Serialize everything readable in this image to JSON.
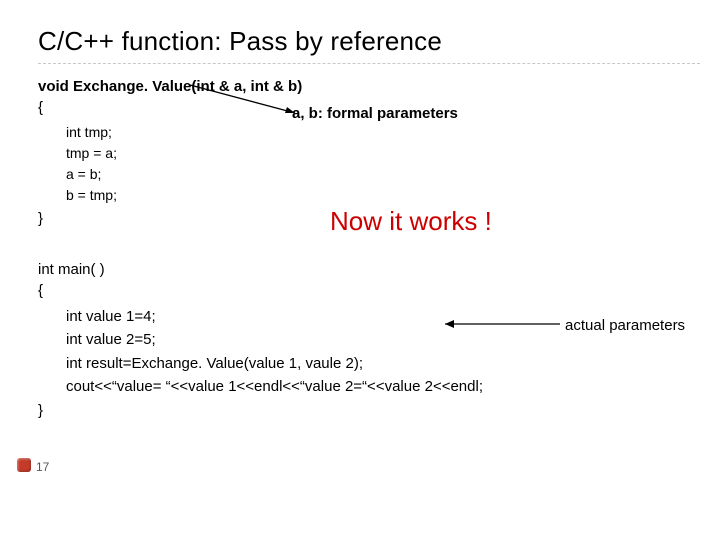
{
  "title": "C/C++ function: Pass by reference",
  "func": {
    "signature": "void Exchange. Value(int & a, int & b)",
    "open": "{",
    "lines": [
      "int tmp;",
      "tmp = a;",
      "a = b;",
      "b = tmp;"
    ],
    "close": "}"
  },
  "formal_label": "a, b: formal parameters",
  "works": "Now it works !",
  "main": {
    "signature": "int main( )",
    "open": "{",
    "lines": [
      "int value 1=4;",
      "int value 2=5;",
      "int result=Exchange. Value(value 1, vaule 2);",
      "cout<<“value= “<<value 1<<endl<<“value 2=“<<value 2<<endl;"
    ],
    "close": "}"
  },
  "actual_label": "actual parameters",
  "page_number": "17",
  "colors": {
    "accent_red": "#cc0000",
    "bullet_red": "#c43b2a"
  }
}
